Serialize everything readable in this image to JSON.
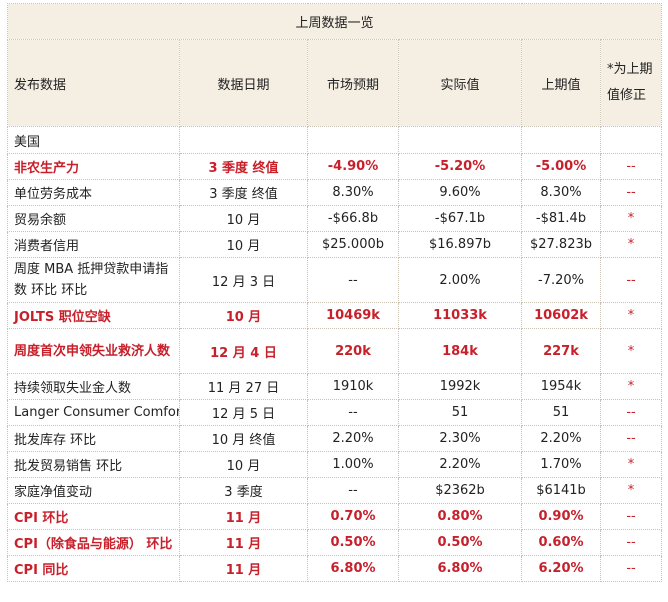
{
  "title": "上周数据一览",
  "headers": {
    "release": "发布数据",
    "date": "数据日期",
    "forecast": "市场预期",
    "actual": "实际值",
    "previous": "上期值",
    "revised": "*为上期值修正"
  },
  "group": "美国",
  "rows": [
    {
      "name": "非农生产力",
      "date": "3 季度  终值",
      "forecast": "-4.90%",
      "actual": "-5.20%",
      "previous": "-5.00%",
      "mark": "--",
      "highlight": true
    },
    {
      "name": "单位劳务成本",
      "date": "3 季度  终值",
      "forecast": "8.30%",
      "actual": "9.60%",
      "previous": "8.30%",
      "mark": "--",
      "highlight": false
    },
    {
      "name": "贸易余额",
      "date": "10 月",
      "forecast": "-$66.8b",
      "actual": "-$67.1b",
      "previous": "-$81.4b",
      "mark": "*",
      "highlight": false
    },
    {
      "name": "消费者信用",
      "date": "10 月",
      "forecast": "$25.000b",
      "actual": "$16.897b",
      "previous": "$27.823b",
      "mark": "*",
      "highlight": false
    },
    {
      "name": "周度 MBA 抵押贷款申请指数  环比  环比",
      "date": "12 月 3 日",
      "forecast": "--",
      "actual": "2.00%",
      "previous": "-7.20%",
      "mark": "--",
      "highlight": false,
      "tall": true
    },
    {
      "name": "JOLTS 职位空缺",
      "date": "10 月",
      "forecast": "10469k",
      "actual": "11033k",
      "previous": "10602k",
      "mark": "*",
      "highlight": true
    },
    {
      "name": "周度首次申领失业救济人数",
      "date": "12 月 4 日",
      "forecast": "220k",
      "actual": "184k",
      "previous": "227k",
      "mark": "*",
      "highlight": true,
      "tall": true
    },
    {
      "name": "持续领取失业金人数",
      "date": "11 月 27 日",
      "forecast": "1910k",
      "actual": "1992k",
      "previous": "1954k",
      "mark": "*",
      "highlight": false
    },
    {
      "name": "Langer Consumer Comfort",
      "date": "12 月 5 日",
      "forecast": "--",
      "actual": "51",
      "previous": "51",
      "mark": "--",
      "highlight": false
    },
    {
      "name": "批发库存  环比",
      "date": "10 月  终值",
      "forecast": "2.20%",
      "actual": "2.30%",
      "previous": "2.20%",
      "mark": "--",
      "highlight": false
    },
    {
      "name": "批发贸易销售  环比",
      "date": "10 月",
      "forecast": "1.00%",
      "actual": "2.20%",
      "previous": "1.70%",
      "mark": "*",
      "highlight": false
    },
    {
      "name": "家庭净值变动",
      "date": "3 季度",
      "forecast": "--",
      "actual": "$2362b",
      "previous": "$6141b",
      "mark": "*",
      "highlight": false
    },
    {
      "name": "CPI  环比",
      "date": "11 月",
      "forecast": "0.70%",
      "actual": "0.80%",
      "previous": "0.90%",
      "mark": "--",
      "highlight": true
    },
    {
      "name": "CPI（除食品与能源） 环比",
      "date": "11 月",
      "forecast": "0.50%",
      "actual": "0.50%",
      "previous": "0.60%",
      "mark": "--",
      "highlight": true
    },
    {
      "name": "CPI  同比",
      "date": "11 月",
      "forecast": "6.80%",
      "actual": "6.80%",
      "previous": "6.20%",
      "mark": "--",
      "highlight": true
    }
  ]
}
